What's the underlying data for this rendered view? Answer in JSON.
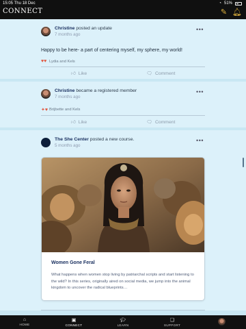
{
  "status": {
    "time": "15:05",
    "date": "Thu 18 Dec",
    "battery": "51%"
  },
  "app": {
    "title": "CONNECT"
  },
  "feed": {
    "posts": [
      {
        "author": "Christine",
        "action": "posted an update",
        "time": "7 months ago",
        "text": "Happy to be here- a part of centering myself, my sphere, my world!",
        "reactions": "Lydia and Kels"
      },
      {
        "author": "Christine",
        "action": "became a registered member",
        "time": "7 months ago",
        "reactions": "Brijbette and Kels"
      },
      {
        "author": "The She Center",
        "action": "posted a new course.",
        "time": "5 months ago",
        "course": {
          "title": "Women Gone Feral",
          "description": "What happens when women stop living by patriarchal scripts and start listening to the wild? In this series, originally aired on social media, we jump into the animal kingdom to uncover the radical blueprints…"
        }
      }
    ],
    "like_label": "Like",
    "comment_label": "Comment"
  },
  "nav": [
    {
      "label": "HOME",
      "icon": "home-icon"
    },
    {
      "label": "CONNECT",
      "icon": "connect-icon"
    },
    {
      "label": "LEARN",
      "icon": "graduation-cap-icon"
    },
    {
      "label": "SUPPORT",
      "icon": "support-icon"
    }
  ],
  "colors": {
    "accent": "#e2b43e",
    "background": "#c9e7f3",
    "card": "#dcf1fa"
  }
}
